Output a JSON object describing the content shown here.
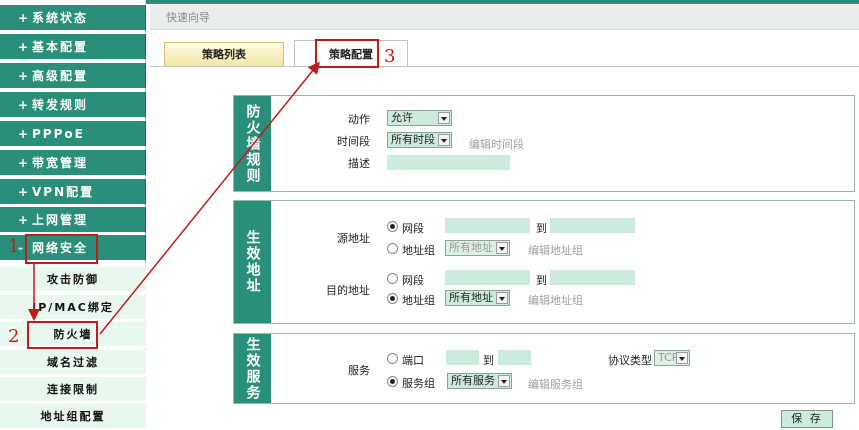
{
  "sidebar": {
    "menu": [
      {
        "prefix": "+",
        "label": "系统状态"
      },
      {
        "prefix": "+",
        "label": "基本配置"
      },
      {
        "prefix": "+",
        "label": "高级配置"
      },
      {
        "prefix": "+",
        "label": "转发规则"
      },
      {
        "prefix": "+",
        "label": "PPPoE"
      },
      {
        "prefix": "+",
        "label": "带宽管理"
      },
      {
        "prefix": "+",
        "label": "VPN配置"
      },
      {
        "prefix": "+",
        "label": "上网管理"
      },
      {
        "prefix": "-",
        "label": "网络安全"
      }
    ],
    "submenu": [
      "攻击防御",
      "IP/MAC绑定",
      "防火墙",
      "域名过滤",
      "连接限制",
      "地址组配置"
    ]
  },
  "breadcrumb": "快速向导",
  "tabs": [
    "策略列表",
    "策略配置"
  ],
  "firewall_rule": {
    "title": "防火墙规则",
    "action_label": "动作",
    "action_value": "允许",
    "time_label": "时间段",
    "time_value": "所有时段",
    "edit_time_link": "编辑时间段",
    "desc_label": "描述"
  },
  "effective_address": {
    "title": "生效地址",
    "source_label": "源地址",
    "dest_label": "目的地址",
    "segment_label": "网段",
    "to_label": "到",
    "group_label": "地址组",
    "group_value": "所有地址",
    "edit_group_link": "编辑地址组"
  },
  "effective_service": {
    "title": "生效服务",
    "service_label": "服务",
    "port_label": "端口",
    "to_label": "到",
    "protocol_label": "协议类型",
    "protocol_value": "TCP",
    "service_group_label": "服务组",
    "service_group_value": "所有服务",
    "edit_service_link": "编辑服务组"
  },
  "save_label": "保 存",
  "annotations": {
    "one": "1",
    "two": "2",
    "three": "3"
  },
  "colors": {
    "accent": "#2a8f7a",
    "field": "#cdebdc",
    "annotation": "#c41a1a"
  }
}
